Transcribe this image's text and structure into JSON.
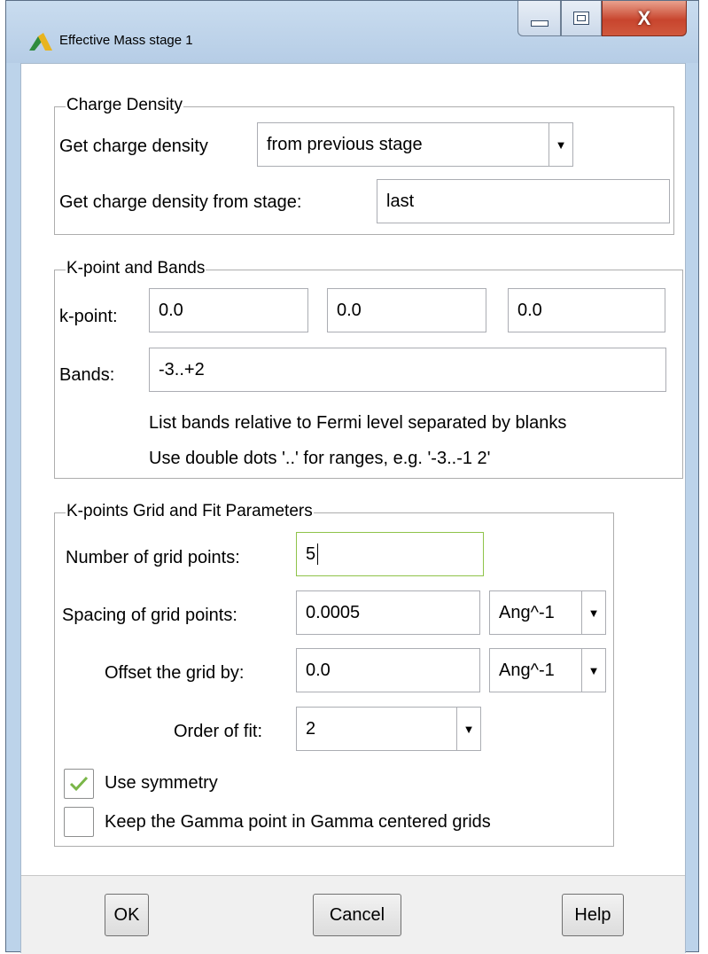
{
  "window": {
    "title": "Effective Mass stage 1",
    "controls": {
      "close_glyph": "X"
    }
  },
  "charge_density": {
    "legend": "Charge Density",
    "get_label": "Get charge density",
    "get_value": "from previous stage",
    "stage_label": "Get charge density from stage:",
    "stage_value": "last"
  },
  "kpoint_bands": {
    "legend": "K-point and Bands",
    "kpoint_label": "k-point:",
    "kpoint": [
      "0.0",
      "0.0",
      "0.0"
    ],
    "bands_label": "Bands:",
    "bands_value": "-3..+2",
    "hint1": "List bands relative to Fermi level separated by blanks",
    "hint2": "Use double dots '..' for ranges, e.g. '-3..-1 2'"
  },
  "grid": {
    "legend": "K-points Grid and Fit Parameters",
    "num_label": "Number of grid points:",
    "num_value": "5",
    "spacing_label": "Spacing of grid points:",
    "spacing_value": "0.0005",
    "spacing_unit": "Ang^-1",
    "offset_label": "Offset the grid by:",
    "offset_value": "0.0",
    "offset_unit": "Ang^-1",
    "order_label": "Order of fit:",
    "order_value": "2",
    "use_symmetry_label": "Use symmetry",
    "use_symmetry_checked": true,
    "keep_gamma_label": "Keep the Gamma point in Gamma centered grids",
    "keep_gamma_checked": false
  },
  "buttons": {
    "ok": "OK",
    "cancel": "Cancel",
    "help": "Help"
  },
  "icons": {
    "app": "app-logo-icon",
    "minimize": "minimize-icon",
    "maximize": "maximize-icon",
    "close": "close-icon",
    "dropdown": "chevron-down-icon",
    "check": "checkmark-icon"
  },
  "colors": {
    "check": "#7ab648",
    "focus_border": "#8fc34a",
    "close_button": "#c8452e"
  }
}
